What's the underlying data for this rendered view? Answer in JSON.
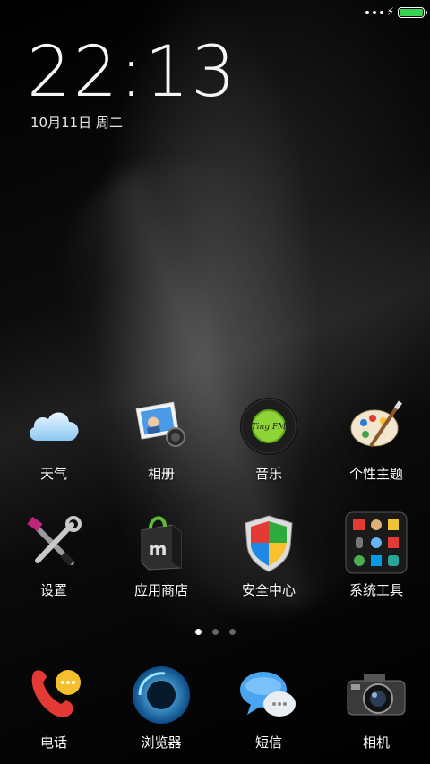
{
  "status_bar": {
    "battery_level": 1.0,
    "battery_color": "#39d353",
    "charging_icon": "bolt-icon",
    "signal_icon": "signal-dots-icon"
  },
  "lockscreen": {
    "time": "22:13",
    "date": "10月11日 周二"
  },
  "home": {
    "row1": [
      {
        "label": "天气",
        "icon": "weather-cloud-icon"
      },
      {
        "label": "相册",
        "icon": "gallery-icon"
      },
      {
        "label": "音乐",
        "icon": "music-icon"
      },
      {
        "label": "个性主题",
        "icon": "themes-palette-icon"
      }
    ],
    "row2": [
      {
        "label": "设置",
        "icon": "settings-tools-icon"
      },
      {
        "label": "应用商店",
        "icon": "app-store-bag-icon"
      },
      {
        "label": "安全中心",
        "icon": "security-shield-icon"
      },
      {
        "label": "系统工具",
        "icon": "system-tools-folder-icon"
      }
    ],
    "page_indicator": {
      "total": 3,
      "active": 1
    },
    "dock": [
      {
        "label": "电话",
        "icon": "phone-icon"
      },
      {
        "label": "浏览器",
        "icon": "browser-icon"
      },
      {
        "label": "短信",
        "icon": "messages-icon"
      },
      {
        "label": "相机",
        "icon": "camera-icon"
      }
    ]
  },
  "music_icon_text": "Ting FM"
}
